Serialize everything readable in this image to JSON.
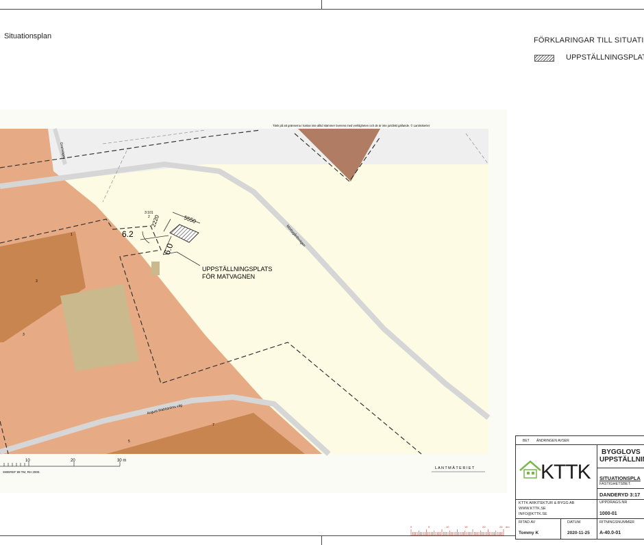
{
  "sheet": {
    "title": "Situationsplan"
  },
  "legend": {
    "title": "FÖRKLARINGAR TILL SITUATION",
    "items": [
      {
        "label": "UPPSTÄLLNINGSPLATS",
        "pattern": "hatch"
      }
    ]
  },
  "map": {
    "disclaimer": "Tänk på att gränserna i kartan inte alltid stämmer överens med verkligheten och de är inte juridiskt gällande. © Lantmäteriet",
    "road_labels": {
      "right": "Mörbygårdsvägen",
      "bottom": "August Wahlströms väg",
      "top": "Granvägen"
    },
    "parcel_labels": [
      "3:101",
      "2",
      "1",
      "3",
      "3",
      "7",
      "5"
    ],
    "dimensions": {
      "width": "5550",
      "depth": "2220",
      "dist_left": "6.2",
      "dist_down": "6.0"
    },
    "annotation": {
      "line1": "UPPSTÄLLNINGSPLATS",
      "line2": "FÖR MATVAGNEN"
    },
    "scalebar": {
      "ticks": [
        "10",
        "20",
        "30 m"
      ],
      "reference": "SWEREF 99 TM, RH 2000."
    },
    "provider": "L A N T M Ä T E R I E T",
    "colors": {
      "built_area": "#e6ab84",
      "building": "#c88550",
      "open_area": "#fdfbe3",
      "road": "#d6d6d6",
      "parking": "#c9b98c",
      "triangle": "#b07d64"
    }
  },
  "title_block": {
    "bet": "BET",
    "andringen": "ÄNDRINGEN AVSER",
    "project_line1": "BYGGLOVS",
    "project_line2": "UPPSTÄLLNIN",
    "drawing_name": "SITUATIONSPLA",
    "fastighet_label": "FASTIGHETSBET.",
    "fastighet_value": "DANDERYD 3:17",
    "company": "KTTK ARKITEKTUR & BYGG AB",
    "web": "WWW.KTTK.SE",
    "email": "INFO@KTTK.SE",
    "logo_text": "KTTK",
    "uppdrag_label": "UPPDRAGS.NR",
    "uppdrag_value": "1000-01",
    "ritad_label": "RITAD AV",
    "ritad_value": "Tommy K",
    "datum_label": "DATUM",
    "datum_value": "2020-11-25",
    "ritningsnr_label": "RITNINGSNUMMER",
    "ritningsnr_value": "A-40.0-01"
  },
  "ruler": {
    "labels": [
      "0",
      "5",
      "10",
      "15",
      "20",
      "25",
      "30"
    ],
    "unit": "dm"
  }
}
